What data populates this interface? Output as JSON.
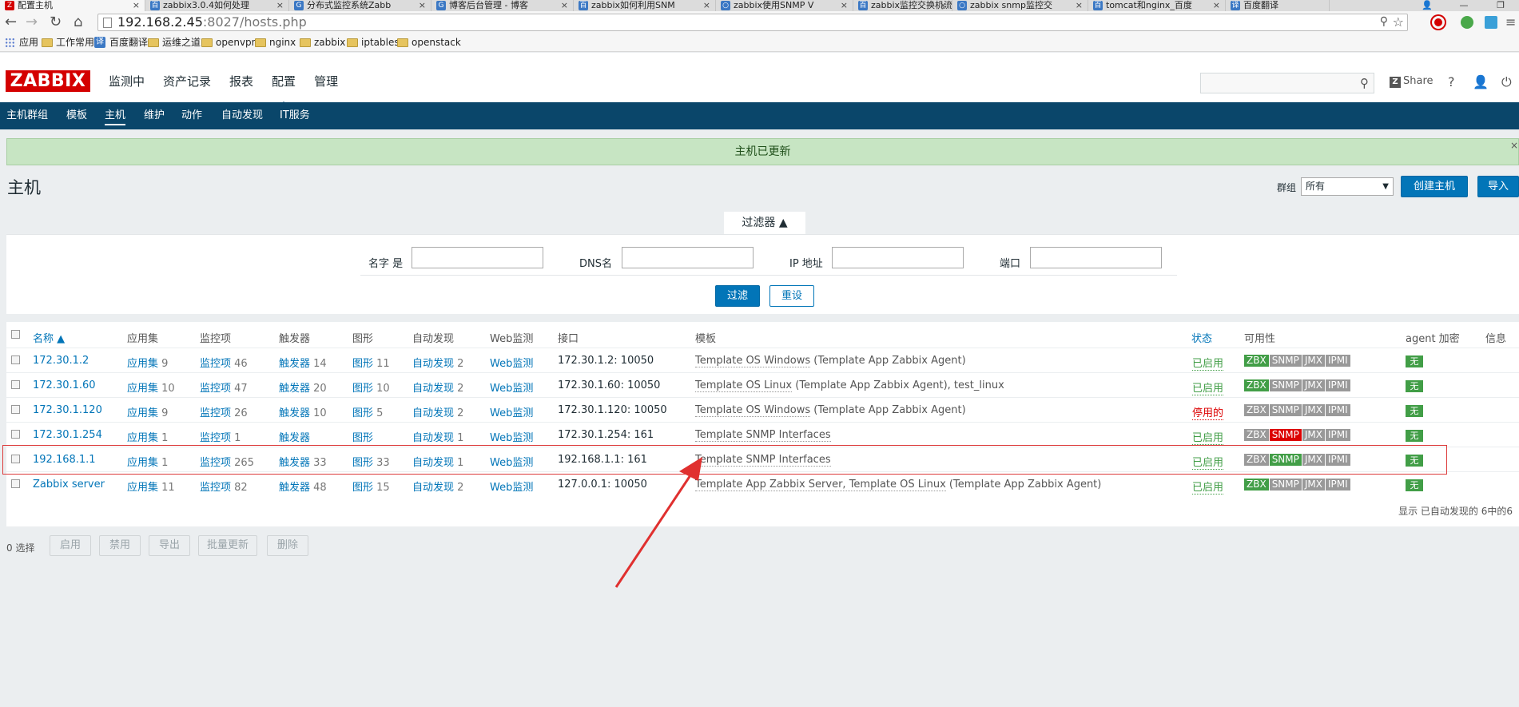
{
  "browser": {
    "tabs": [
      {
        "title": "配置主机",
        "active": true,
        "fav": "Z"
      },
      {
        "title": "zabbix3.0.4如何处理",
        "fav": "百"
      },
      {
        "title": "分布式监控系统Zabb",
        "fav": "G"
      },
      {
        "title": "博客后台管理 - 博客",
        "fav": "G"
      },
      {
        "title": "zabbix如何利用SNM",
        "fav": "百"
      },
      {
        "title": "zabbix使用SNMP V",
        "fav": "○"
      },
      {
        "title": "zabbix监控交换机流",
        "fav": "百"
      },
      {
        "title": "zabbix snmp监控交",
        "fav": "○"
      },
      {
        "title": "tomcat和nginx_百度",
        "fav": "百"
      },
      {
        "title": "百度翻译",
        "fav": "译"
      }
    ],
    "url_host": "192.168.2.45",
    "url_path": ":8027/hosts.php",
    "bookmarks": [
      "应用",
      "工作常用",
      "百度翻译",
      "运维之道",
      "openvpn",
      "nginx",
      "zabbix",
      "iptables",
      "openstack"
    ]
  },
  "header": {
    "logo": "ZABBIX",
    "menu": [
      "监测中",
      "资产记录",
      "报表",
      "配置",
      "管理"
    ],
    "share": "Share",
    "help": "?",
    "user": "👤",
    "power": "⏻"
  },
  "subnav": [
    "主机群组",
    "模板",
    "主机",
    "维护",
    "动作",
    "自动发现",
    "IT服务"
  ],
  "message": "主机已更新",
  "page": {
    "title": "主机",
    "group_label": "群组",
    "group_value": "所有",
    "create_button": "创建主机",
    "import_button": "导入"
  },
  "filter": {
    "tab_label": "过滤器 ▲",
    "name_label": "名字 是",
    "dns_label": "DNS名",
    "ip_label": "IP 地址",
    "port_label": "端口",
    "apply_button": "过滤",
    "reset_button": "重设"
  },
  "table": {
    "headers": [
      "名称 ▲",
      "应用集",
      "监控项",
      "触发器",
      "图形",
      "自动发现",
      "Web监测",
      "接口",
      "模板",
      "状态",
      "可用性",
      "agent 加密",
      "信息"
    ],
    "rows": [
      {
        "name": "172.30.1.2",
        "apps": "应用集",
        "apps_n": "9",
        "items": "监控项",
        "items_n": "46",
        "triggers": "触发器",
        "triggers_n": "14",
        "graphs": "图形",
        "graphs_n": "11",
        "disc": "自动发现",
        "disc_n": "2",
        "web": "Web监测",
        "iface": "172.30.1.2: 10050",
        "tpl_main": "Template OS Windows",
        "tpl_extra": " (Template App Zabbix Agent)",
        "status": "已启用",
        "avail": [
          "ZBX",
          "SNMP",
          "JMX",
          "IPMI"
        ],
        "zbx": "g",
        "snmp": "",
        "enc": "无"
      },
      {
        "name": "172.30.1.60",
        "apps": "应用集",
        "apps_n": "10",
        "items": "监控项",
        "items_n": "47",
        "triggers": "触发器",
        "triggers_n": "20",
        "graphs": "图形",
        "graphs_n": "10",
        "disc": "自动发现",
        "disc_n": "2",
        "web": "Web监测",
        "iface": "172.30.1.60: 10050",
        "tpl_main": "Template OS Linux",
        "tpl_extra": " (Template App Zabbix Agent), test_linux",
        "status": "已启用",
        "avail": [
          "ZBX",
          "SNMP",
          "JMX",
          "IPMI"
        ],
        "zbx": "g",
        "snmp": "",
        "enc": "无"
      },
      {
        "name": "172.30.1.120",
        "apps": "应用集",
        "apps_n": "9",
        "items": "监控项",
        "items_n": "26",
        "triggers": "触发器",
        "triggers_n": "10",
        "graphs": "图形",
        "graphs_n": "5",
        "disc": "自动发现",
        "disc_n": "2",
        "web": "Web监测",
        "iface": "172.30.1.120: 10050",
        "tpl_main": "Template OS Windows",
        "tpl_extra": " (Template App Zabbix Agent)",
        "status": "停用的",
        "avail": [
          "ZBX",
          "SNMP",
          "JMX",
          "IPMI"
        ],
        "zbx": "",
        "snmp": "",
        "enc": "无"
      },
      {
        "name": "172.30.1.254",
        "apps": "应用集",
        "apps_n": "1",
        "items": "监控项",
        "items_n": "1",
        "triggers": "触发器",
        "triggers_n": "",
        "graphs": "图形",
        "graphs_n": "",
        "disc": "自动发现",
        "disc_n": "1",
        "web": "Web监测",
        "iface": "172.30.1.254: 161",
        "tpl_main": "Template SNMP Interfaces",
        "tpl_extra": "",
        "status": "已启用",
        "avail": [
          "ZBX",
          "SNMP",
          "JMX",
          "IPMI"
        ],
        "zbx": "",
        "snmp": "r",
        "enc": "无"
      },
      {
        "name": "192.168.1.1",
        "apps": "应用集",
        "apps_n": "1",
        "items": "监控项",
        "items_n": "265",
        "triggers": "触发器",
        "triggers_n": "33",
        "graphs": "图形",
        "graphs_n": "33",
        "disc": "自动发现",
        "disc_n": "1",
        "web": "Web监测",
        "iface": "192.168.1.1: 161",
        "tpl_main": "Template SNMP Interfaces",
        "tpl_extra": "",
        "status": "已启用",
        "avail": [
          "ZBX",
          "SNMP",
          "JMX",
          "IPMI"
        ],
        "zbx": "",
        "snmp": "g",
        "enc": "无"
      },
      {
        "name": "Zabbix server",
        "apps": "应用集",
        "apps_n": "11",
        "items": "监控项",
        "items_n": "82",
        "triggers": "触发器",
        "triggers_n": "48",
        "graphs": "图形",
        "graphs_n": "15",
        "disc": "自动发现",
        "disc_n": "2",
        "web": "Web监测",
        "iface": "127.0.0.1: 10050",
        "tpl_main": "Template App Zabbix Server, Template OS Linux",
        "tpl_extra": " (Template App Zabbix Agent)",
        "status": "已启用",
        "avail": [
          "ZBX",
          "SNMP",
          "JMX",
          "IPMI"
        ],
        "zbx": "g",
        "snmp": "",
        "enc": "无"
      }
    ],
    "summary": "显示 已自动发现的 6中的6"
  },
  "actions": {
    "selected": "0 选择",
    "buttons": [
      "启用",
      "禁用",
      "导出",
      "批量更新",
      "删除"
    ]
  }
}
